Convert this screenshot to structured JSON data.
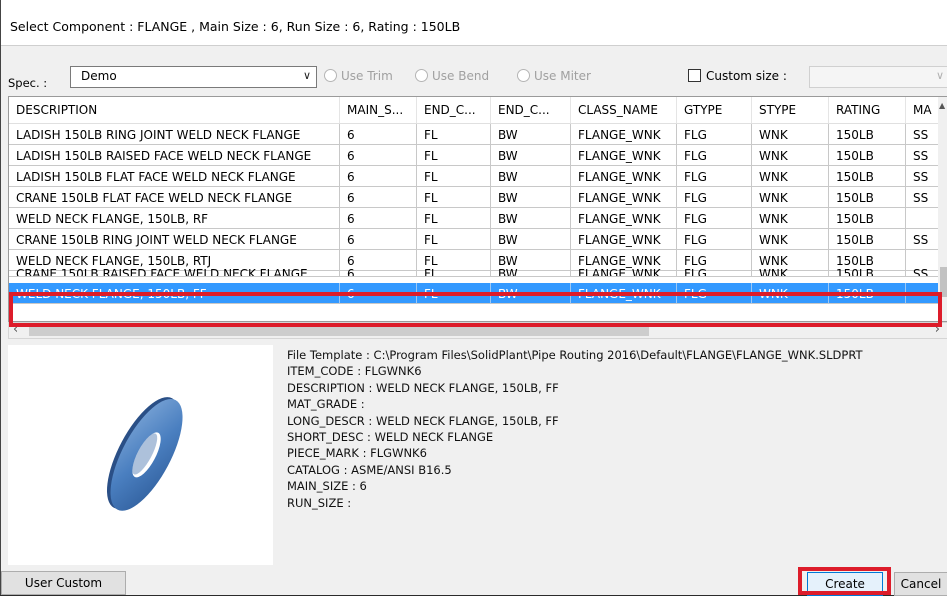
{
  "dialog": {
    "title": "Select Component : FLANGE , Main Size : 6, Run Size : 6, Rating : 150LB"
  },
  "filters": {
    "spec_label": "Spec. :",
    "spec_value": "Demo",
    "use_trim": "Use Trim",
    "use_bend": "Use Bend",
    "use_miter": "Use Miter",
    "custom_size": "Custom size :"
  },
  "grid": {
    "columns": [
      "DESCRIPTION",
      "MAIN_S...",
      "END_C...",
      "END_C...",
      "CLASS_NAME",
      "GTYPE",
      "STYPE",
      "RATING",
      "MA"
    ],
    "rows": [
      [
        "LADISH 150LB RING JOINT WELD NECK FLANGE",
        "6",
        "FL",
        "BW",
        "FLANGE_WNK",
        "FLG",
        "WNK",
        "150LB",
        "SS"
      ],
      [
        "LADISH 150LB RAISED FACE WELD NECK FLANGE",
        "6",
        "FL",
        "BW",
        "FLANGE_WNK",
        "FLG",
        "WNK",
        "150LB",
        "SS"
      ],
      [
        "LADISH 150LB FLAT FACE WELD NECK FLANGE",
        "6",
        "FL",
        "BW",
        "FLANGE_WNK",
        "FLG",
        "WNK",
        "150LB",
        "SS"
      ],
      [
        "CRANE 150LB FLAT FACE WELD NECK FLANGE",
        "6",
        "FL",
        "BW",
        "FLANGE_WNK",
        "FLG",
        "WNK",
        "150LB",
        "SS"
      ],
      [
        "WELD NECK FLANGE, 150LB, RF",
        "6",
        "FL",
        "BW",
        "FLANGE_WNK",
        "FLG",
        "WNK",
        "150LB",
        ""
      ],
      [
        "CRANE 150LB RING JOINT WELD NECK FLANGE",
        "6",
        "FL",
        "BW",
        "FLANGE_WNK",
        "FLG",
        "WNK",
        "150LB",
        "SS"
      ],
      [
        "WELD NECK FLANGE, 150LB, RTJ",
        "6",
        "FL",
        "BW",
        "FLANGE_WNK",
        "FLG",
        "WNK",
        "150LB",
        ""
      ],
      [
        "CRANE 150LB RAISED FACE WELD NECK FLANGE",
        "6",
        "FL",
        "BW",
        "FLANGE_WNK",
        "FLG",
        "WNK",
        "150LB",
        "SS"
      ],
      [
        "WELD NECK FLANGE, 150LB, FF",
        "6",
        "FL",
        "BW",
        "FLANGE_WNK",
        "FLG",
        "WNK",
        "150LB",
        ""
      ]
    ],
    "selected_row": 8
  },
  "details": {
    "lines": [
      "File Template : C:\\Program Files\\SolidPlant\\Pipe Routing 2016\\Default\\FLANGE\\FLANGE_WNK.SLDPRT",
      "ITEM_CODE : FLGWNK6",
      "DESCRIPTION : WELD NECK FLANGE, 150LB, FF",
      "MAT_GRADE :",
      "LONG_DESCR : WELD NECK FLANGE, 150LB, FF",
      "SHORT_DESC : WELD NECK FLANGE",
      "PIECE_MARK : FLGWNK6",
      "CATALOG : ASME/ANSI B16.5",
      "MAIN_SIZE : 6",
      "RUN_SIZE :"
    ]
  },
  "buttons": {
    "user_custom": "User Custom",
    "create": "Create",
    "cancel": "Cancel"
  },
  "colors": {
    "selection": "#3399ff",
    "highlight": "#dd1c2a"
  }
}
